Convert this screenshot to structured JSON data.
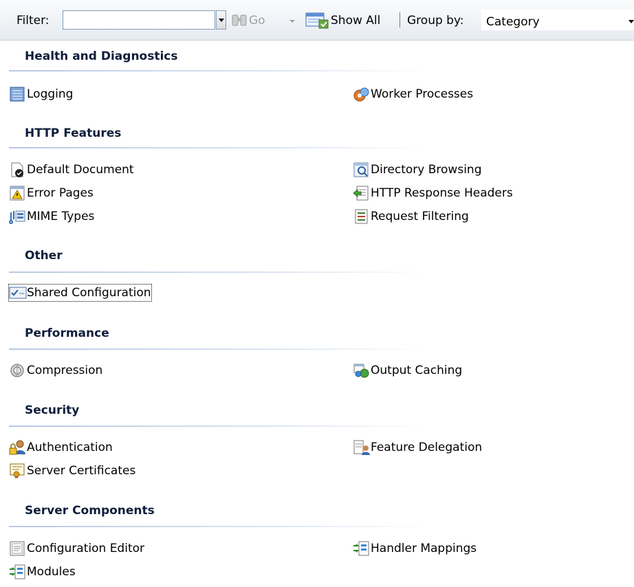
{
  "toolbar": {
    "filter_label": "Filter:",
    "filter_value": "",
    "go_label": "Go",
    "show_all_label": "Show All",
    "group_by_label": "Group by:",
    "group_by_value": "Category"
  },
  "groups": [
    {
      "title": "Health and Diagnostics",
      "items": [
        {
          "label": "Logging",
          "icon": "logging-icon"
        },
        {
          "label": "Worker Processes",
          "icon": "worker-processes-icon"
        }
      ]
    },
    {
      "title": "HTTP Features",
      "items": [
        {
          "label": "Default Document",
          "icon": "default-document-icon"
        },
        {
          "label": "Directory Browsing",
          "icon": "directory-browsing-icon"
        },
        {
          "label": "Error Pages",
          "icon": "error-pages-icon"
        },
        {
          "label": "HTTP Response Headers",
          "icon": "http-response-headers-icon"
        },
        {
          "label": "MIME Types",
          "icon": "mime-types-icon"
        },
        {
          "label": "Request Filtering",
          "icon": "request-filtering-icon"
        }
      ]
    },
    {
      "title": "Other",
      "items": [
        {
          "label": "Shared Configuration",
          "icon": "shared-configuration-icon",
          "selected": true
        }
      ]
    },
    {
      "title": "Performance",
      "items": [
        {
          "label": "Compression",
          "icon": "compression-icon"
        },
        {
          "label": "Output Caching",
          "icon": "output-caching-icon"
        }
      ]
    },
    {
      "title": "Security",
      "items": [
        {
          "label": "Authentication",
          "icon": "authentication-icon"
        },
        {
          "label": "Feature Delegation",
          "icon": "feature-delegation-icon"
        },
        {
          "label": "Server Certificates",
          "icon": "server-certificates-icon"
        }
      ]
    },
    {
      "title": "Server Components",
      "items": [
        {
          "label": "Configuration Editor",
          "icon": "configuration-editor-icon"
        },
        {
          "label": "Handler Mappings",
          "icon": "handler-mappings-icon"
        },
        {
          "label": "Modules",
          "icon": "modules-icon"
        }
      ]
    }
  ]
}
